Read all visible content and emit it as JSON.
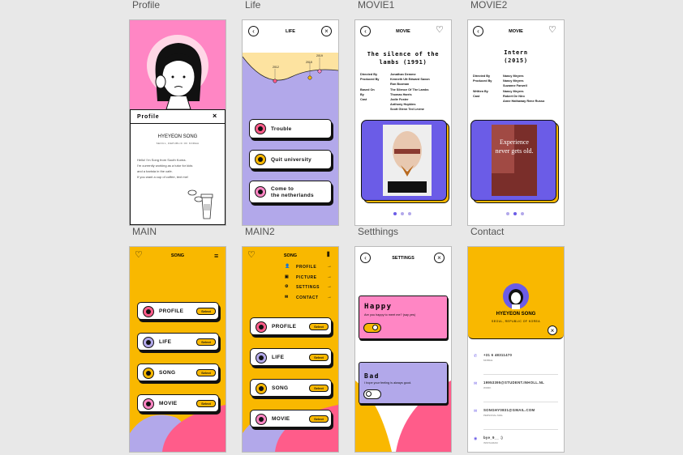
{
  "labels": {
    "profile": "Profile",
    "life": "Life",
    "movie1": "MOVIE1",
    "movie2": "MOVIE2",
    "main": "MAIN",
    "main2": "MAIN2",
    "settings": "Setthings",
    "contact": "Contact"
  },
  "profile": {
    "card_title": "Profile",
    "close": "×",
    "name": "HYEYEON SONG",
    "place": "SEOUL, REPUBLIC OF KOREA",
    "bio": [
      "Hello! I'm Song from South Korea.",
      "I'm currently working as a tutor for kids",
      "and a barista in the cafe.",
      "If you want a cup of coffee, text me!"
    ]
  },
  "life": {
    "title": "LIFE",
    "years": [
      "2012",
      "2015",
      "2019"
    ],
    "items": [
      "Trouble",
      "Quit university",
      "Come to",
      "the netherlands"
    ]
  },
  "movie1": {
    "header": "MOVIE",
    "title": "The silence of the lambs (1991)",
    "credits": [
      [
        "Directed By",
        "Jonathan Demme"
      ],
      [
        "Produced By",
        "Kenneth Utt Edward Saxon"
      ],
      [
        "",
        "Ron Bozman"
      ],
      [
        "Based On",
        "The Silence Of The Lambs"
      ],
      [
        "By",
        "Thomas Harris"
      ],
      [
        "Cast",
        "Jodie Foster"
      ],
      [
        "",
        "Anthony Hopkins"
      ],
      [
        "",
        "Scott Glenn Ted Levine"
      ]
    ]
  },
  "movie2": {
    "header": "MOVIE",
    "title": "Intern (2015)",
    "poster_text": "Experience never gets old.",
    "credits": [
      [
        "Directed By",
        "Nancy Meyers"
      ],
      [
        "Produced By",
        "Nancy Meyers"
      ],
      [
        "",
        "Suzanne Farwell"
      ],
      [
        "Written By",
        "Nancy Meyers"
      ],
      [
        "Cast",
        "Robert De Niro"
      ],
      [
        "",
        "Anne Hathaway Rene Russo"
      ]
    ]
  },
  "main": {
    "title": "SONG",
    "items": [
      "PROFILE",
      "LIFE",
      "SONG",
      "MOVIE"
    ],
    "select": "Select"
  },
  "main2": {
    "title": "SONG",
    "menu": [
      "PROFILE",
      "PICTURE",
      "SETTINGS",
      "CONTACT"
    ],
    "items": [
      "PROFILE",
      "LIFE",
      "SONG",
      "MOVIE"
    ],
    "select": "Select"
  },
  "settings": {
    "title": "SETTINGS",
    "happy": "Happy",
    "happy_q": "Are you happy to meet me? (say yes)",
    "bad": "Bad",
    "bad_q": "I hope your feeling is always good."
  },
  "contact": {
    "name": "HYEYEON SONG",
    "place": "SEOUL, REPUBLIC OF KOREA",
    "rows": [
      [
        "+31 6 48311470",
        "MOBILE"
      ],
      [
        "19953395@STUDENT.INHOLL.NL",
        "WORK"
      ],
      [
        "SONGHY0831@GMAIL.COM",
        "PERSONAL MAIL"
      ],
      [
        "bye_9__ :)",
        "INSTAGRAM"
      ]
    ]
  },
  "colors": {
    "yellow": "#f9b800",
    "pink": "#ff86c4",
    "lavender": "#b2a8ea",
    "purple": "#6b5ce7"
  }
}
